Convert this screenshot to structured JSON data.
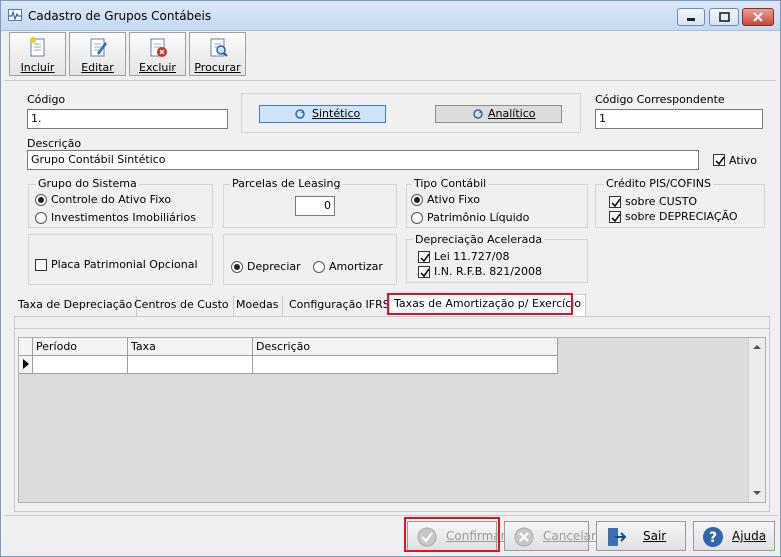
{
  "window": {
    "title": "Cadastro de Grupos Contábeis"
  },
  "toolbar": {
    "incluir": "Incluir",
    "editar": "Editar",
    "excluir": "Excluir",
    "procurar": "Procurar"
  },
  "form": {
    "codigo_label": "Código",
    "codigo_value": "1.",
    "sintetico_label": "Sintético",
    "analitico_label": "Analítico",
    "codigo_correspondente_label": "Código Correspondente",
    "codigo_correspondente_value": "1",
    "descricao_label": "Descrição",
    "descricao_value": "Grupo Contábil Sintético",
    "ativo_label": "Ativo"
  },
  "grupo_sistema": {
    "title": "Grupo do Sistema",
    "opt1": "Controle do Ativo Fixo",
    "opt2": "Investimentos Imobiliários"
  },
  "parcelas": {
    "title": "Parcelas de Leasing",
    "value": "0"
  },
  "tipo_contabil": {
    "title": "Tipo Contábil",
    "opt1": "Ativo Fixo",
    "opt2": "Patrimônio Líquido"
  },
  "credito": {
    "title": "Crédito PIS/COFINS",
    "opt1": "sobre CUSTO",
    "opt2": "sobre DEPRECIAÇÃO"
  },
  "placa": {
    "label": "Placa Patrimonial Opcional"
  },
  "depreciar": {
    "opt1": "Depreciar",
    "opt2": "Amortizar"
  },
  "depreciacao_acelerada": {
    "title": "Depreciação Acelerada",
    "opt1": "Lei 11.727/08",
    "opt2": "I.N. R.F.B. 821/2008"
  },
  "tabs": [
    "Taxa de Depreciação",
    "Centros de Custo",
    "Moedas",
    "Configuração IFRS",
    "Taxas de Amortização p/ Exercício"
  ],
  "grid": {
    "columns": [
      "Período",
      "Taxa",
      "Descrição"
    ]
  },
  "footer": {
    "confirmar": "Confirmar",
    "cancelar": "Cancelar",
    "sair": "Sair",
    "ajuda": "Ajuda"
  }
}
